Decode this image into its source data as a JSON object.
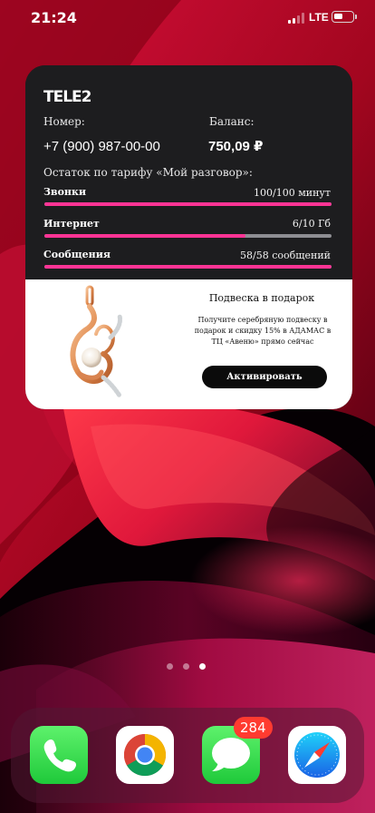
{
  "status_bar": {
    "time": "21:24",
    "network": "LTE",
    "signal_bars": [
      "active",
      "active",
      "dim",
      "dim"
    ]
  },
  "widget": {
    "brand": "TELE2",
    "number_label": "Номер:",
    "number": "+7 (900) 987-00-00",
    "balance_label": "Баланс:",
    "balance": "750,09 ₽",
    "tariff_label": "Остаток по тарифу «Мой разговор»:",
    "accent_color": "#ff3495",
    "usage": [
      {
        "name": "Звонки",
        "value": "100/100 минут",
        "fraction": 1.0
      },
      {
        "name": "Интернет",
        "value": "6/10 Гб",
        "fraction": 0.7
      },
      {
        "name": "Сообщения",
        "value": "58/58 сообщений",
        "fraction": 1.0
      }
    ],
    "promo": {
      "title": "Подвеска в подарок",
      "text": "Получите серебряную подвеску в подарок и скидку 15% в АДАМАС в ТЦ «Авеню» прямо сейчас",
      "button": "Активировать",
      "image": "pendant-icon"
    }
  },
  "home": {
    "page_count": 3,
    "current_page": 3
  },
  "dock": {
    "apps": [
      "phone-icon",
      "chrome-icon",
      "messages-icon",
      "safari-icon"
    ],
    "messages_badge": "284"
  }
}
